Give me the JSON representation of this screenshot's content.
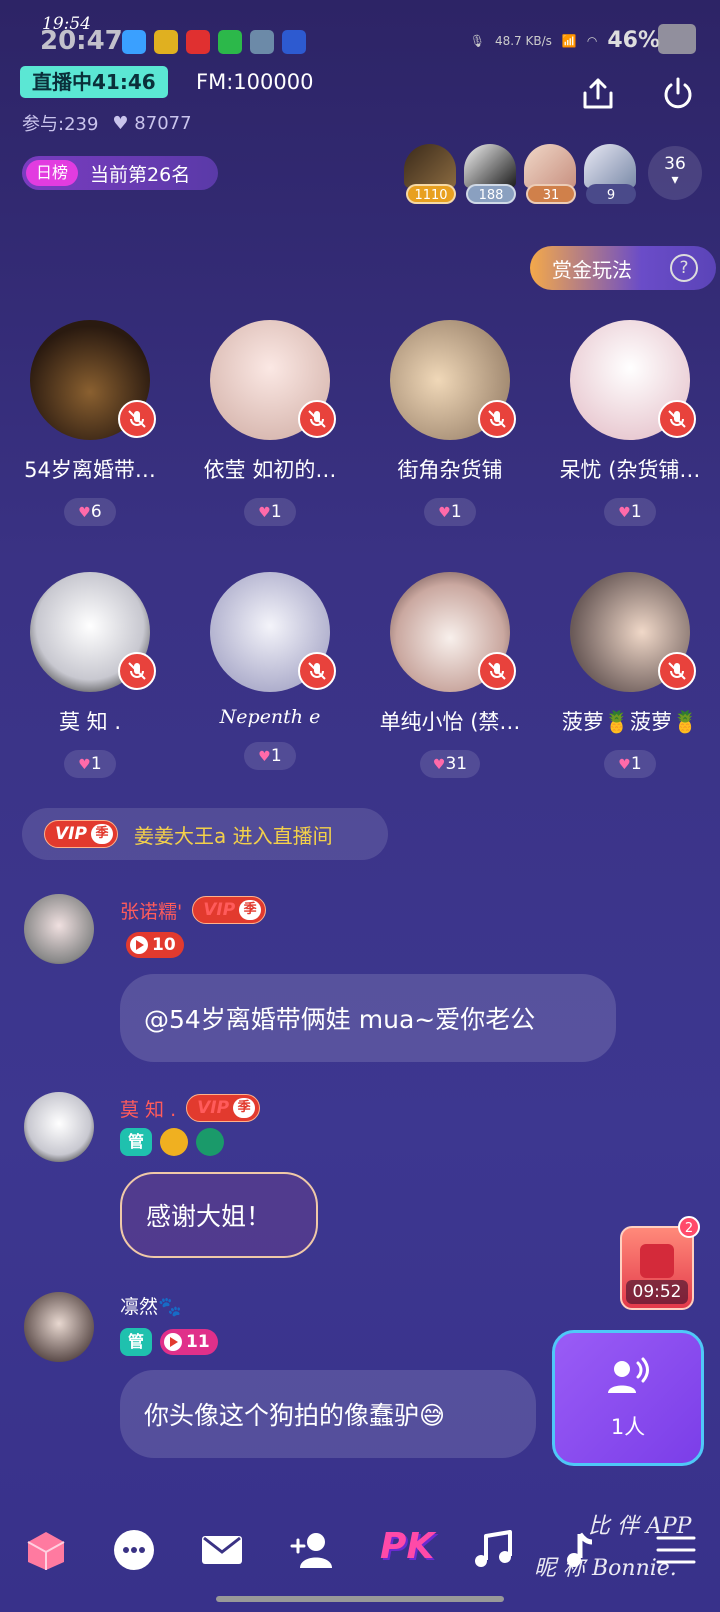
{
  "status_bar": {
    "time_small": "19:54",
    "time": "20:47",
    "speed": "48.7 KB/s",
    "battery": "46%"
  },
  "header": {
    "live_label": "直播中41:46",
    "fm": "FM:100000",
    "participants": "参与:239",
    "likes": "87077",
    "rank_tag": "日榜",
    "rank_text": "当前第26名",
    "fan_counts": [
      "1110",
      "188",
      "31",
      "9"
    ],
    "online_count": "36",
    "bounty_label": "赏金玩法"
  },
  "seats": [
    {
      "name": "54岁离婚带…",
      "likes": "6"
    },
    {
      "name": "依莹 如初的…",
      "likes": "1"
    },
    {
      "name": "街角杂货铺",
      "likes": "1"
    },
    {
      "name": "呆忧 (杂货铺…",
      "likes": "1"
    },
    {
      "name": "莫 知 .",
      "likes": "1"
    },
    {
      "name": "Nepenth e",
      "likes": "1"
    },
    {
      "name": "单纯小怡 (禁…",
      "likes": "31"
    },
    {
      "name": "菠萝🍍菠萝🍍",
      "likes": "1"
    }
  ],
  "enter_notice": {
    "vip": "VIP",
    "season": "季",
    "text": "姜姜大王a 进入直播间"
  },
  "messages": [
    {
      "name": "张诺糯'",
      "level": "10",
      "text": "@54岁离婚带俩娃 mua~爱你老公"
    },
    {
      "name": "莫 知 .",
      "guan": "管",
      "text": "感谢大姐！"
    },
    {
      "name": "凛然🐾",
      "guan": "管",
      "level": "11",
      "text": "你头像这个狗拍的像蠢驴😅"
    }
  ],
  "red_packet": {
    "badge": "2",
    "timer": "09:52"
  },
  "mic_queue": {
    "label": "1人"
  },
  "bottom": {
    "pk_label": "PK"
  },
  "watermark": {
    "line1": "比 伴 APP",
    "line2": "昵 称 Bonnie."
  },
  "colors": {
    "accent_teal": "#5be7d4",
    "vip_red": "#e23a2e",
    "enter_yellow": "#f3d04a",
    "name_red": "#ff5b5b"
  }
}
